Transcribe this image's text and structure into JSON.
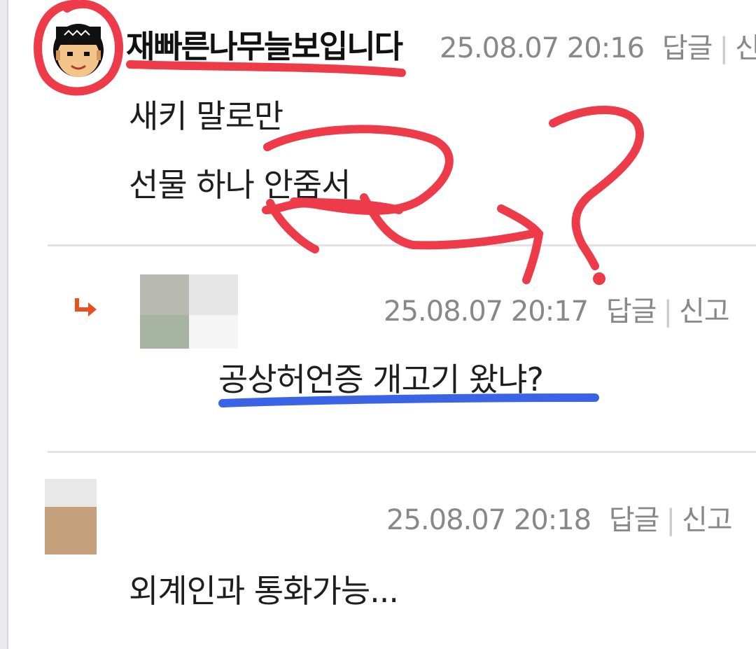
{
  "comments": [
    {
      "nickname": "재빠른나무늘보입니다",
      "timestamp": "25.08.07 20:16",
      "reply_label": "답글",
      "report_label": "신고",
      "lines": [
        "새키 말로만",
        "선물 하나 안줌서"
      ]
    },
    {
      "timestamp": "25.08.07 20:17",
      "reply_label": "답글",
      "report_label": "신고",
      "lines": [
        "공상허언증 개고기 왔냐?"
      ]
    },
    {
      "timestamp": "25.08.07 20:18",
      "reply_label": "답글",
      "report_label": "신고",
      "lines": [
        "외계인과 통화가능..."
      ]
    }
  ],
  "annotation_text": "ㅋ?",
  "colors": {
    "annotation_red": "#ee3b4a",
    "annotation_blue": "#3a63e6",
    "reply_arrow": "#e8501e"
  },
  "icons": [
    "reply-arrow-icon",
    "separator-bar"
  ]
}
